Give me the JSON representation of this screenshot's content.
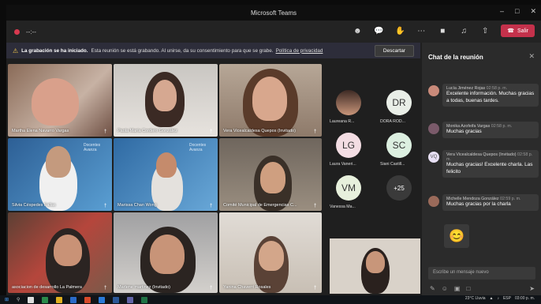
{
  "window": {
    "title": "Microsoft Teams"
  },
  "toolbar": {
    "timer": "--:--",
    "leave_label": "Salir"
  },
  "banner": {
    "title": "La grabación se ha iniciado.",
    "text": "Esta reunión se está grabando. Al unirse, da su consentimiento para que se grabe.",
    "link": "Política de privacidad",
    "dismiss": "Descartar"
  },
  "tiles": [
    {
      "name": "Martha Elena Navarro Vargas"
    },
    {
      "name": "Paola María Cordero González"
    },
    {
      "name": "Vera Vicealcaldesa Quepos (Invitado)"
    },
    {
      "name": "Silvia Céspedes Fallas"
    },
    {
      "name": "Marissa Chan Wong"
    },
    {
      "name": "Comité Municipal de Emergencias C..."
    },
    {
      "name": "asociacion de desarrollo La Palmera"
    },
    {
      "name": "Marlene martinez (Invitado)"
    },
    {
      "name": "Yanina Chaverri Rosales"
    }
  ],
  "tile_overlay": {
    "brand": "Docentes Avanza"
  },
  "roster": [
    {
      "initials": "",
      "name": "Laureana R..."
    },
    {
      "initials": "DR",
      "name": "DORA ROD..."
    },
    {
      "initials": "LG",
      "name": "Laura Vaneri..."
    },
    {
      "initials": "SC",
      "name": "Siani Castill..."
    },
    {
      "initials": "VM",
      "name": "Vanessa Ma..."
    },
    {
      "initials": "+25",
      "name": ""
    }
  ],
  "chat": {
    "title": "Chat de la reunión",
    "messages": [
      {
        "author": "Lucía Jiménez Rojas",
        "time": "02:58 p. m.",
        "text": "Excelente información. Muchas gracias a todas, buenas tardes."
      },
      {
        "author": "Monika Azofeifa Vargas",
        "time": "02:58 p. m.",
        "text": "Muchas gracias"
      },
      {
        "author": "Vera Vicealcaldesa Quepos (Invitado)",
        "time": "02:58 p. m.",
        "text": "Muchas gracias! Excelente charla. Las felicito"
      },
      {
        "author": "Michelle Mendoza González",
        "time": "02:59 p. m.",
        "text": "Muchas gracias por la charla"
      }
    ],
    "vv_initials": "VQ",
    "emoji": "😊",
    "compose_placeholder": "Escribe un mensaje nuevo"
  },
  "taskbar": {
    "weather": "23°C Lluvia",
    "lang": "ESP",
    "time": "03:00 p. m."
  },
  "colors": {
    "leave": "#c4314b",
    "accent": "#6264a7",
    "chat_bg": "#2b2b2b"
  }
}
